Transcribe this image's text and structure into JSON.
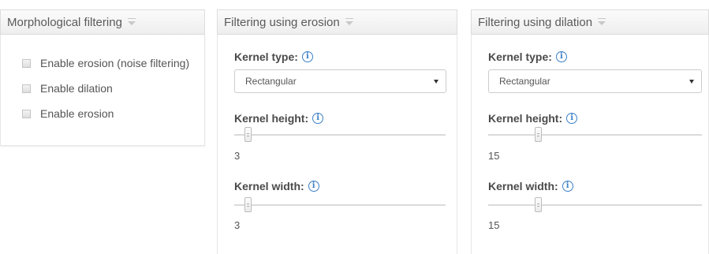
{
  "morph_panel": {
    "title": "Morphological filtering",
    "options": [
      {
        "label": "Enable erosion (noise filtering)",
        "checked": false
      },
      {
        "label": "Enable dilation",
        "checked": false
      },
      {
        "label": "Enable erosion",
        "checked": false
      }
    ]
  },
  "erosion_panel": {
    "title": "Filtering using erosion",
    "kernel_type_label": "Kernel type:",
    "kernel_type_value": "Rectangular",
    "kernel_height_label": "Kernel height:",
    "kernel_height_value": "3",
    "kernel_width_label": "Kernel width:",
    "kernel_width_value": "3"
  },
  "dilation_panel": {
    "title": "Filtering using dilation",
    "kernel_type_label": "Kernel type:",
    "kernel_type_value": "Rectangular",
    "kernel_height_label": "Kernel height:",
    "kernel_height_value": "15",
    "kernel_width_label": "Kernel width:",
    "kernel_width_value": "15"
  },
  "icons": {
    "info": "i",
    "info_color": "#3a7fc6"
  }
}
